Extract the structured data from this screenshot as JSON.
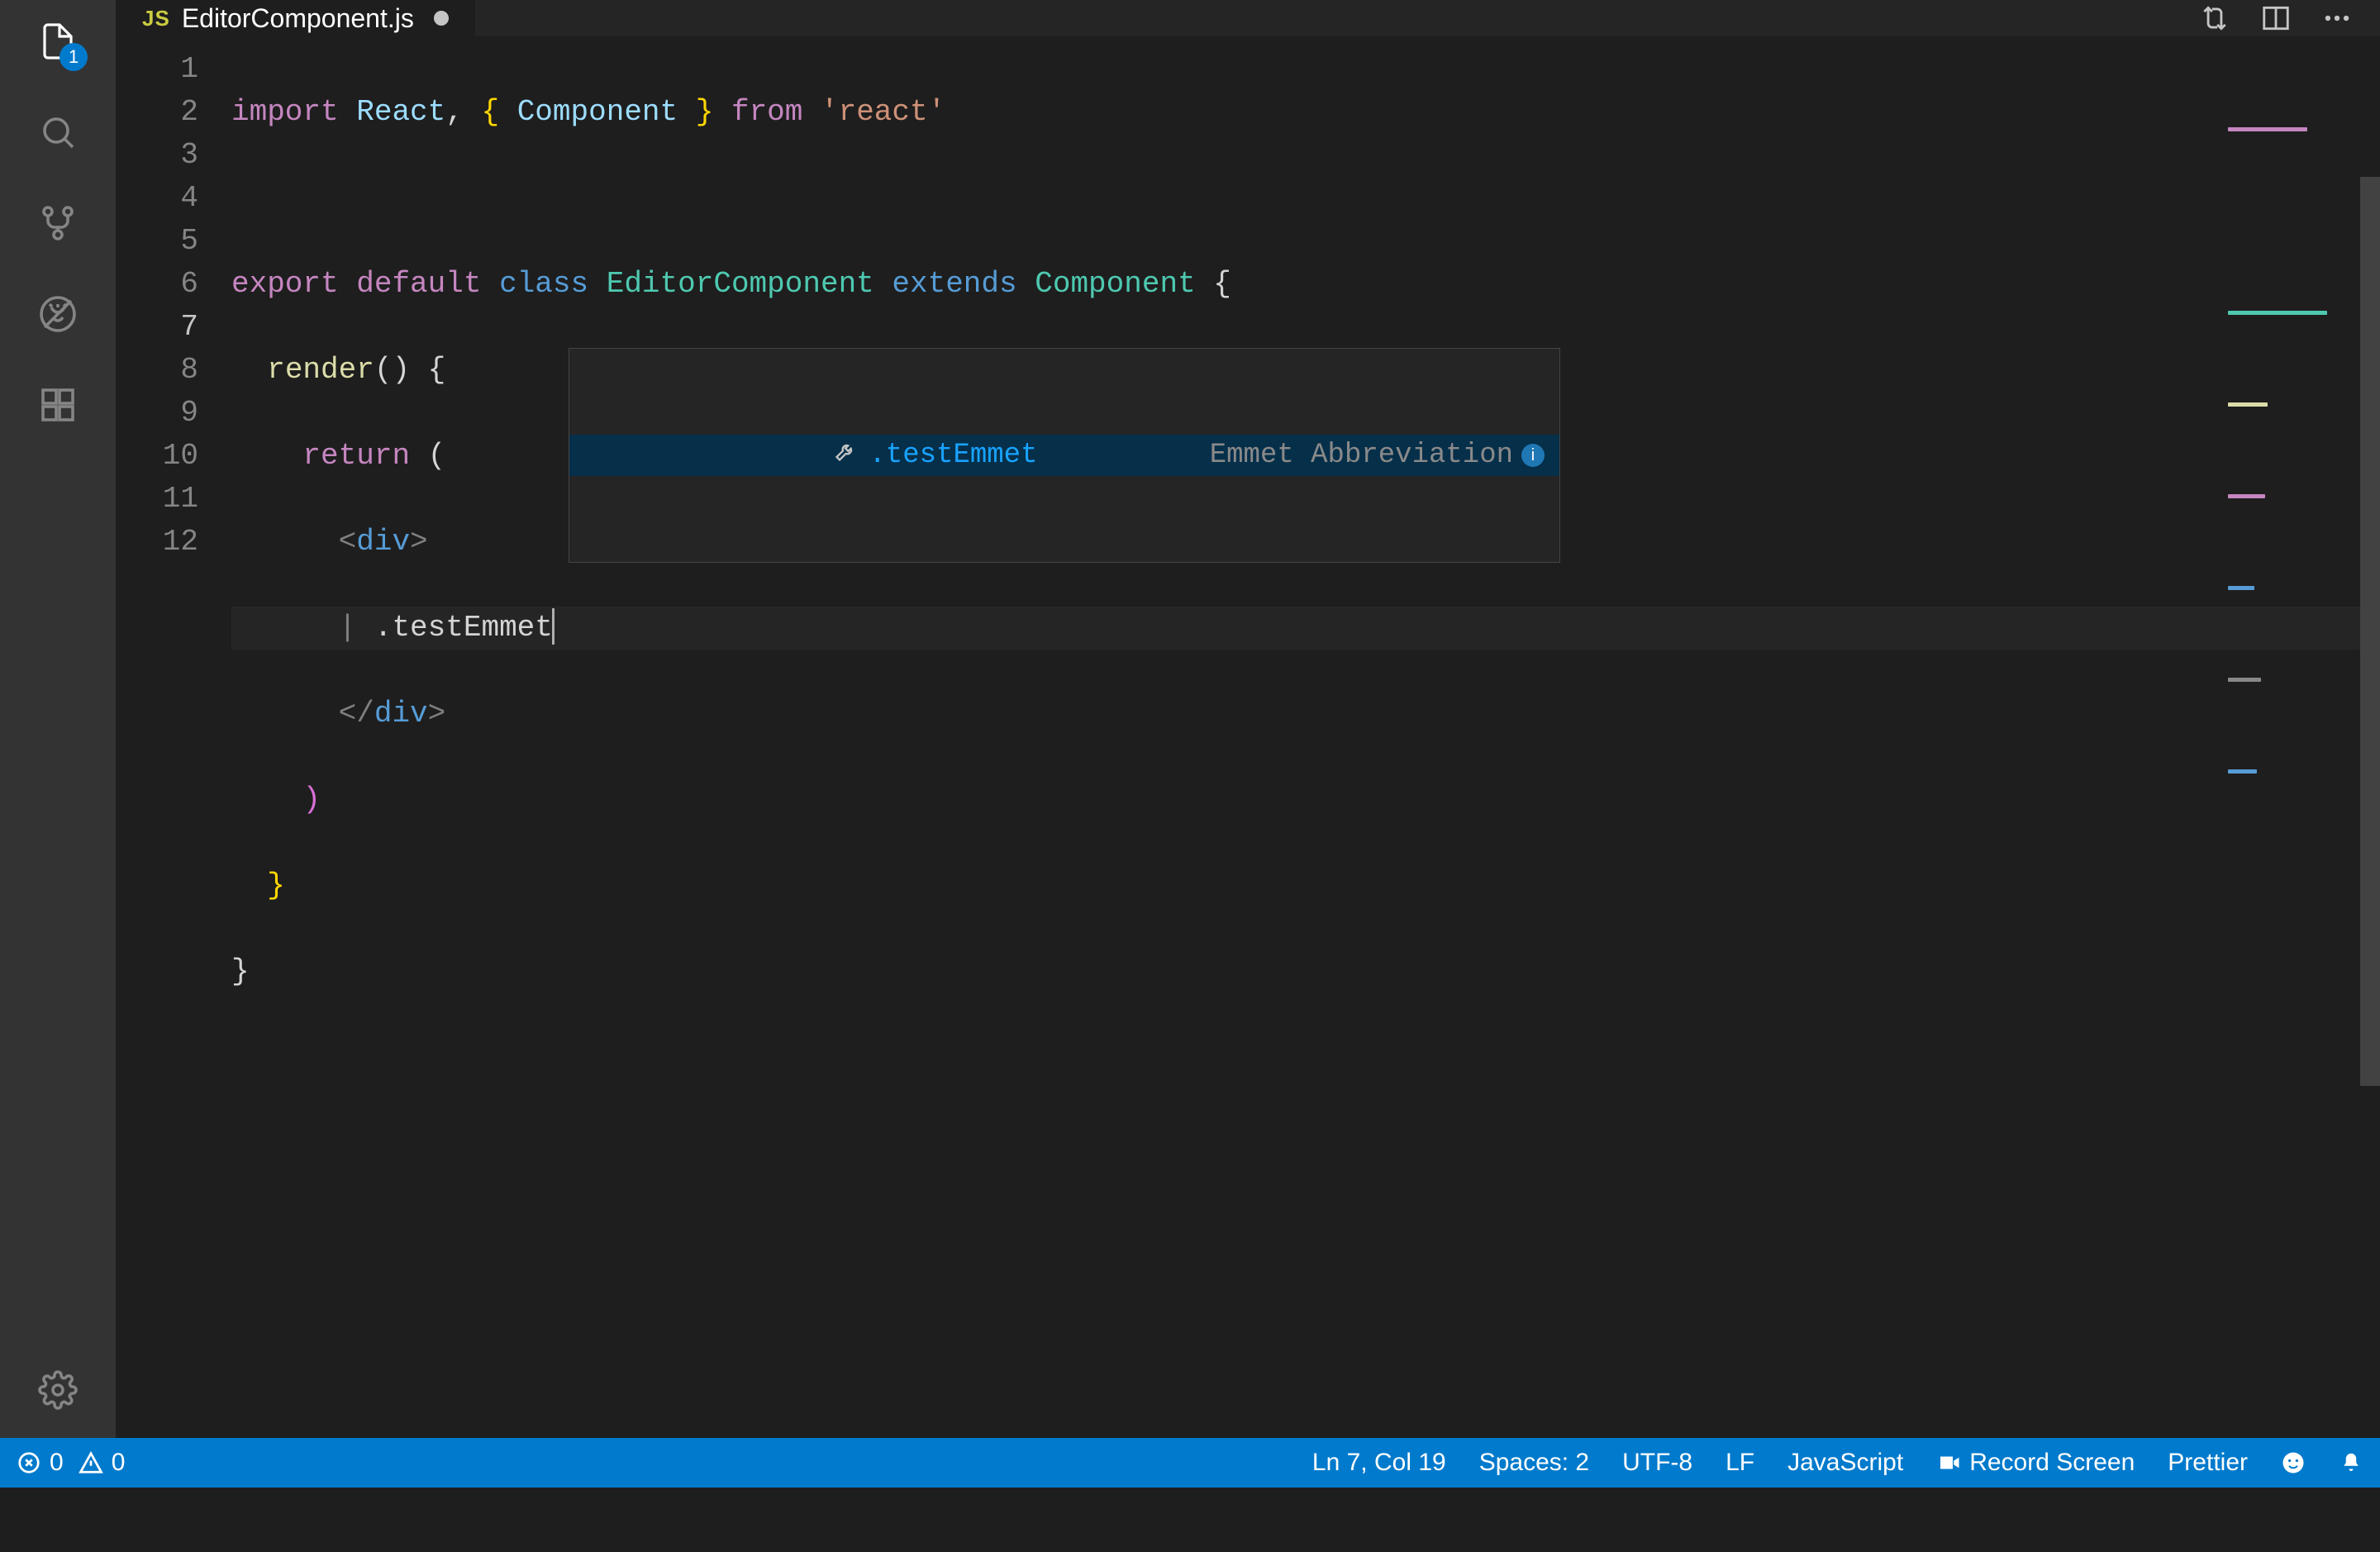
{
  "activity": {
    "explorer_badge": "1"
  },
  "tab": {
    "lang_badge": "JS",
    "filename": "EditorComponent.js"
  },
  "gutter": [
    "1",
    "2",
    "3",
    "4",
    "5",
    "6",
    "7",
    "8",
    "9",
    "10",
    "11",
    "12"
  ],
  "code": {
    "line7_typed": ".testEmmet"
  },
  "suggest": {
    "label": ".testEmmet",
    "detail": "Emmet Abbreviation",
    "info_char": "i"
  },
  "status": {
    "errors": "0",
    "warnings": "0",
    "ln_col": "Ln 7, Col 19",
    "spaces": "Spaces: 2",
    "encoding": "UTF-8",
    "eol": "LF",
    "language": "JavaScript",
    "record": "Record Screen",
    "prettier": "Prettier"
  },
  "colors": {
    "accent": "#007acc",
    "bg": "#1e1e1e"
  }
}
